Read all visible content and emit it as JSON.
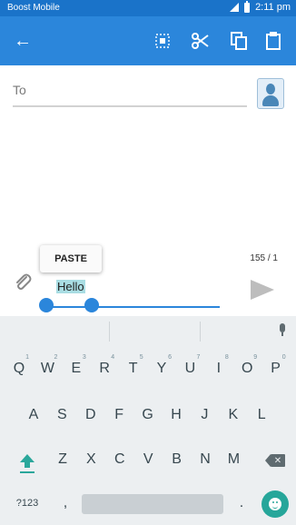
{
  "status_bar": {
    "carrier": "Boost Mobile",
    "time": "2:11 pm"
  },
  "app_bar": {
    "actions": [
      "back",
      "select-all",
      "cut",
      "copy",
      "paste"
    ]
  },
  "compose": {
    "to_label": "To",
    "paste_label": "PASTE",
    "counter": "155 / 1",
    "message_text": "Hello"
  },
  "keyboard": {
    "row1": [
      {
        "key": "Q",
        "num": "1"
      },
      {
        "key": "W",
        "num": "2"
      },
      {
        "key": "E",
        "num": "3"
      },
      {
        "key": "R",
        "num": "4"
      },
      {
        "key": "T",
        "num": "5"
      },
      {
        "key": "Y",
        "num": "6"
      },
      {
        "key": "U",
        "num": "7"
      },
      {
        "key": "I",
        "num": "8"
      },
      {
        "key": "O",
        "num": "9"
      },
      {
        "key": "P",
        "num": "0"
      }
    ],
    "row2": [
      "A",
      "S",
      "D",
      "F",
      "G",
      "H",
      "J",
      "K",
      "L"
    ],
    "row3": [
      "Z",
      "X",
      "C",
      "V",
      "B",
      "N",
      "M"
    ],
    "symbols_label": "?123",
    "comma": ",",
    "period": "."
  },
  "colors": {
    "status_bar": "#1a73c9",
    "app_bar": "#2b86db",
    "accent": "#2b86db",
    "selection": "#a9dde3",
    "keyboard_bg": "#eceff1",
    "emoji_key": "#26a69a"
  }
}
